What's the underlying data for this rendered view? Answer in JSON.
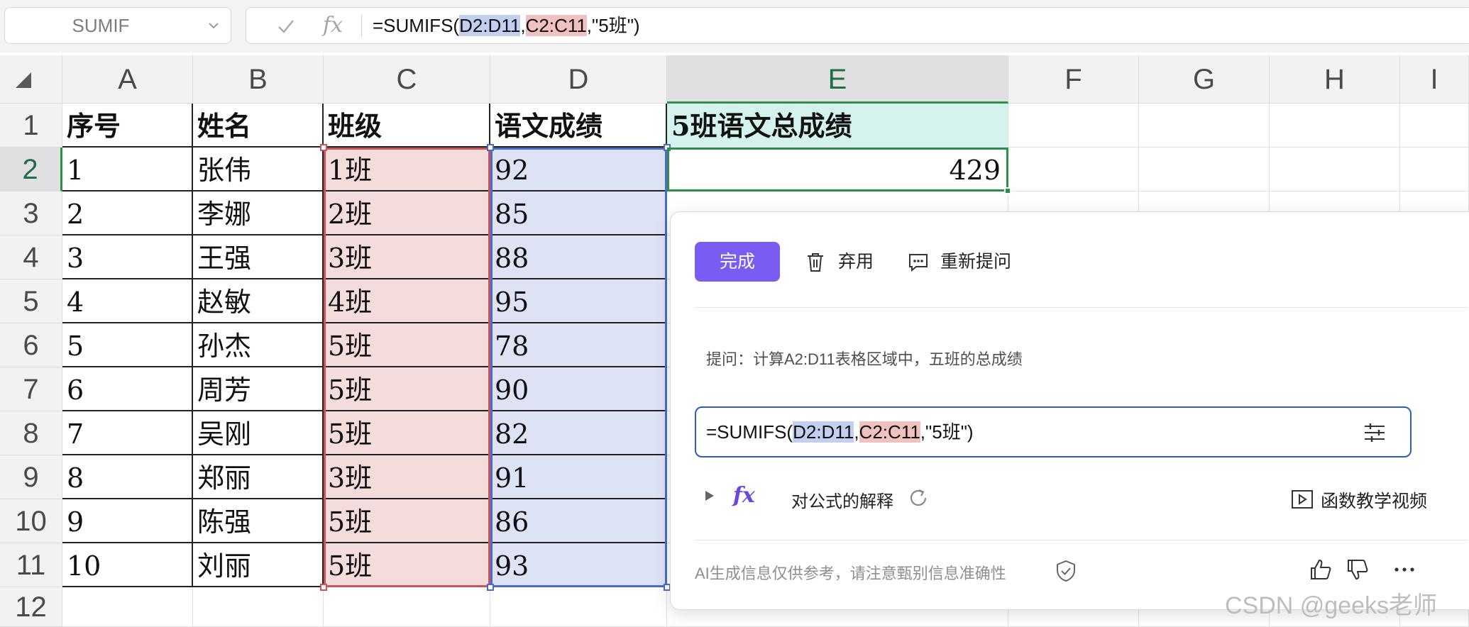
{
  "formula_bar": {
    "name_box": "SUMIF",
    "formula_prefix": "=SUMIFS(",
    "formula_ref1": "D2:D11",
    "formula_comma1": ",",
    "formula_ref2": "C2:C11",
    "formula_suffix": ",\"5班\")"
  },
  "columns": [
    "A",
    "B",
    "C",
    "D",
    "E",
    "F",
    "G",
    "H",
    "I"
  ],
  "rows": [
    "1",
    "2",
    "3",
    "4",
    "5",
    "6",
    "7",
    "8",
    "9",
    "10",
    "11",
    "12"
  ],
  "header_row": [
    "序号",
    "姓名",
    "班级",
    "语文成绩",
    "5班语文总成绩"
  ],
  "table": [
    [
      "1",
      "张伟",
      "1班",
      "92"
    ],
    [
      "2",
      "李娜",
      "2班",
      "85"
    ],
    [
      "3",
      "王强",
      "3班",
      "88"
    ],
    [
      "4",
      "赵敏",
      "4班",
      "95"
    ],
    [
      "5",
      "孙杰",
      "5班",
      "78"
    ],
    [
      "6",
      "周芳",
      "5班",
      "90"
    ],
    [
      "7",
      "吴刚",
      "5班",
      "82"
    ],
    [
      "8",
      "郑丽",
      "3班",
      "91"
    ],
    [
      "9",
      "陈强",
      "5班",
      "86"
    ],
    [
      "10",
      "刘丽",
      "5班",
      "93"
    ]
  ],
  "result_cell": "429",
  "ai_panel": {
    "done": "完成",
    "discard": "弃用",
    "reask": "重新提问",
    "question": "提问：计算A2:D11表格区域中，五班的总成绩",
    "formula_prefix": "=SUMIFS(",
    "formula_ref1": "D2:D11",
    "formula_comma1": ",",
    "formula_ref2": "C2:C11",
    "formula_suffix": ",\"5班\")",
    "explain": "对公式的解释",
    "fx_symbol": "fx",
    "video": "函数教学视频",
    "disclaimer": "AI生成信息仅供参考，请注意甄别信息准确性"
  },
  "watermark": "CSDN @geeks老师",
  "colors": {
    "accent": "#7b5cf2",
    "selected": "#2e8f4b",
    "ref_blue": "#4a6cc9",
    "ref_red": "#c9555a"
  }
}
